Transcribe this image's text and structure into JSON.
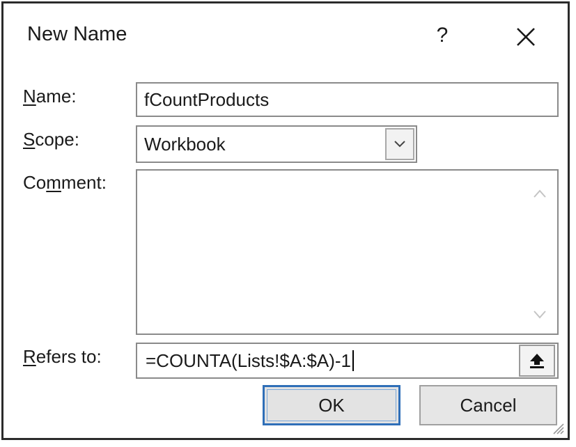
{
  "dialog": {
    "title": "New Name",
    "help_glyph": "?",
    "close_icon": "close-icon"
  },
  "fields": {
    "name_label": "Name:",
    "name_value": "fCountProducts",
    "scope_label": "Scope:",
    "scope_value": "Workbook",
    "comment_label": "Comment:",
    "comment_value": "",
    "refers_label": "Refers to:",
    "refers_value": "=COUNTA(Lists!$A:$A)-1"
  },
  "buttons": {
    "ok_label": "OK",
    "cancel_label": "Cancel"
  },
  "colors": {
    "default_button_border": "#2f6fb8"
  }
}
